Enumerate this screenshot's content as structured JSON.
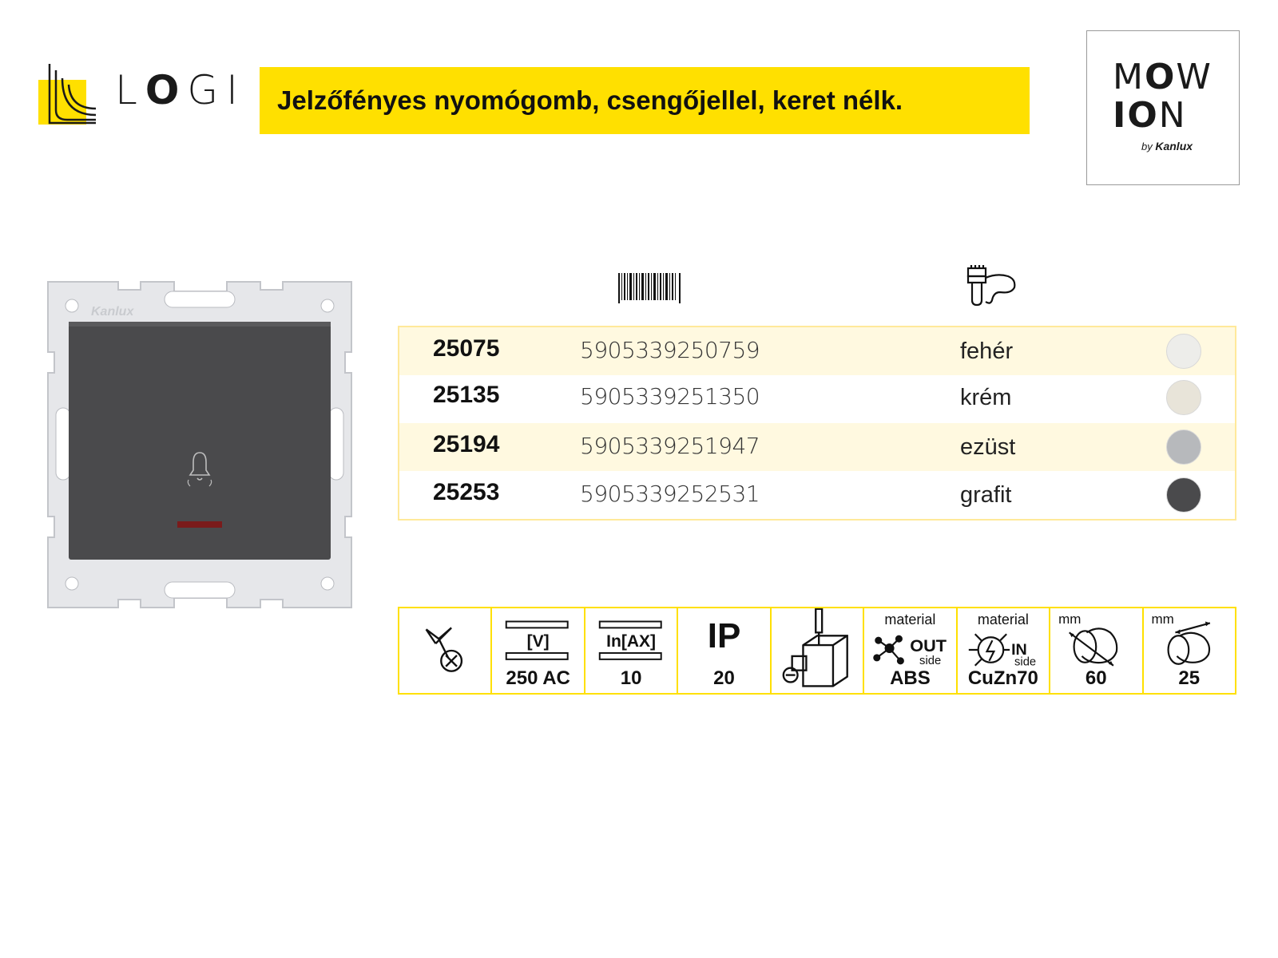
{
  "brand": {
    "logo_text": "LOGI",
    "logo_bold_letter": "O"
  },
  "title": "Jelzőfényes nyomógomb, csengőjellel, keret nélk.",
  "partner_logo": {
    "line1": "MOW",
    "line2": "ION",
    "byline_prefix": "by",
    "byline_brand": "Kanlux"
  },
  "product_image": {
    "alt": "switch-module-graphite",
    "frame_brand": "Kanlux"
  },
  "columns": {
    "barcode_icon": "barcode-icon",
    "color_icon": "paint-brush-icon"
  },
  "variants": [
    {
      "code": "25075",
      "ean": "5905339250759",
      "color": "fehér",
      "swatch": "#ededea"
    },
    {
      "code": "25135",
      "ean": "5905339251350",
      "color": "krém",
      "swatch": "#e8e4d9"
    },
    {
      "code": "25194",
      "ean": "5905339251947",
      "color": "ezüst",
      "swatch": "#b7b9bc"
    },
    {
      "code": "25253",
      "ean": "5905339252531",
      "color": "grafit",
      "swatch": "#4a4a4c"
    }
  ],
  "specs": {
    "mount": {
      "icon": "flush-mount-icon",
      "value": ""
    },
    "voltage": {
      "label": "[V]",
      "value": "250 AC"
    },
    "current": {
      "label": "In[AX]",
      "value": "10"
    },
    "ip": {
      "label": "IP",
      "value": "20"
    },
    "terminal": {
      "icon": "screw-terminal-icon",
      "value": ""
    },
    "material_out": {
      "label": "material",
      "badge": "OUT",
      "sub": "side",
      "value": "ABS"
    },
    "material_in": {
      "label": "material",
      "badge": "IN",
      "sub": "side",
      "value": "CuZn70"
    },
    "diameter": {
      "unit": "mm",
      "value": "60"
    },
    "depth": {
      "unit": "mm",
      "value": "25"
    }
  },
  "colors": {
    "accent_yellow": "#ffe000",
    "row_tint": "#fff9e0"
  }
}
